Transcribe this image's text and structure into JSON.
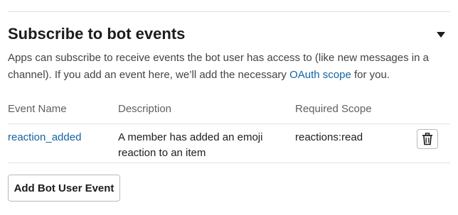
{
  "section": {
    "title": "Subscribe to bot events",
    "description_before_link": "Apps can subscribe to receive events the bot user has access to (like new messages in a channel). If you add an event here, we’ll add the necessary ",
    "description_link": "OAuth scope",
    "description_after_link": " for you.",
    "toggle_icon": "caret-down-icon"
  },
  "table": {
    "headers": {
      "event_name": "Event Name",
      "description": "Description",
      "required_scope": "Required Scope"
    },
    "rows": [
      {
        "event_name": "reaction_added",
        "description": "A member has added an emoji reaction to an item",
        "required_scope": "reactions:read",
        "action_icon": "trash-icon"
      }
    ]
  },
  "add_button_label": "Add Bot User Event",
  "colors": {
    "link": "#1264a3",
    "text": "#1d1c1d",
    "muted": "#616061",
    "divider": "#e2e2e2"
  }
}
